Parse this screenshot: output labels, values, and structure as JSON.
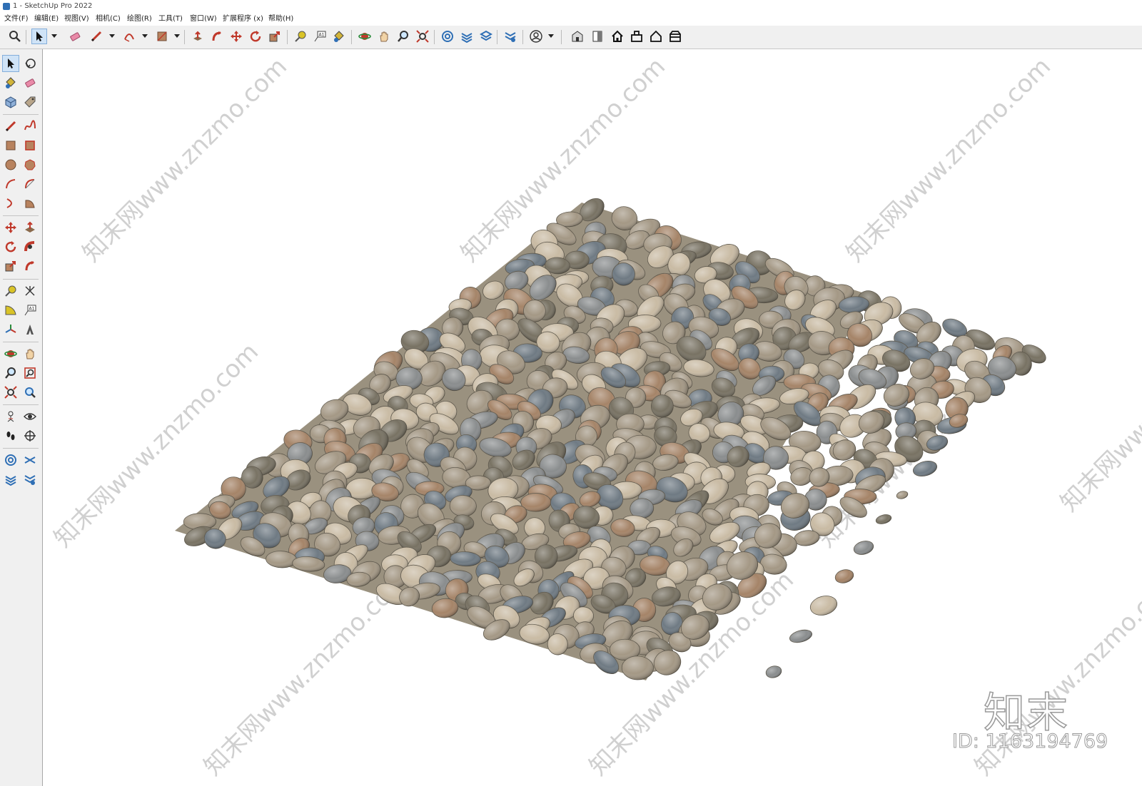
{
  "window": {
    "title": "1 - SketchUp Pro 2022"
  },
  "menubar": {
    "items": [
      "文件(F)",
      "编辑(E)",
      "视图(V)",
      "相机(C)",
      "绘图(R)",
      "工具(T)",
      "窗口(W)",
      "扩展程序 (x)",
      "帮助(H)"
    ]
  },
  "toolbar": {
    "icons": [
      "search-icon",
      "select-icon",
      "eraser-icon",
      "pencil-icon",
      "arc-icon",
      "rectangle-icon",
      "push-pull-icon",
      "follow-me-icon",
      "move-icon",
      "rotate-icon",
      "scale-icon",
      "tape-measure-icon",
      "text-icon",
      "paint-bucket-icon",
      "orbit-icon",
      "pan-icon",
      "zoom-icon",
      "zoom-extents-icon",
      "sandbox-icon",
      "layers-icon",
      "tags-icon",
      "settings-icon",
      "user-icon",
      "warehouse-icon",
      "components-icon",
      "home-icon",
      "extension-icon",
      "house-icon",
      "section-icon"
    ]
  },
  "left_toolbar": {
    "icons": [
      "select-icon",
      "orbit-icon",
      "paint-bucket-icon",
      "eraser-icon",
      "components-icon",
      "tag-icon",
      "pencil-icon",
      "freehand-icon",
      "rectangle-icon",
      "rotated-rectangle-icon",
      "circle-icon",
      "polygon-icon",
      "arc-icon",
      "2-point-arc-icon",
      "3-point-arc-icon",
      "pie-icon",
      "move-icon",
      "push-pull-icon",
      "rotate-icon",
      "follow-me-icon",
      "scale-icon",
      "offset-icon",
      "tape-measure-icon",
      "dimension-icon",
      "protractor-icon",
      "text-icon",
      "axes-icon",
      "3d-text-icon",
      "orbit-icon-2",
      "pan-icon",
      "zoom-icon",
      "zoom-window-icon",
      "zoom-extents-icon",
      "previous-view-icon",
      "walk-icon",
      "look-around-icon",
      "footprints-icon",
      "position-camera-icon",
      "sandbox-smoove-icon",
      "stamp-icon",
      "drape-icon",
      "add-detail-icon"
    ]
  },
  "viewport": {
    "watermark_text": "知末网www.znzmo.com",
    "brand_logo": "知末",
    "model_id": "ID: 1163194769",
    "colors": {
      "stone_light": "#c9bba4",
      "stone_mid": "#a49885",
      "stone_dark": "#787263",
      "stone_grey": "#8a8d8e",
      "stone_rust": "#a58468",
      "stone_blue": "#6f7a83"
    }
  }
}
